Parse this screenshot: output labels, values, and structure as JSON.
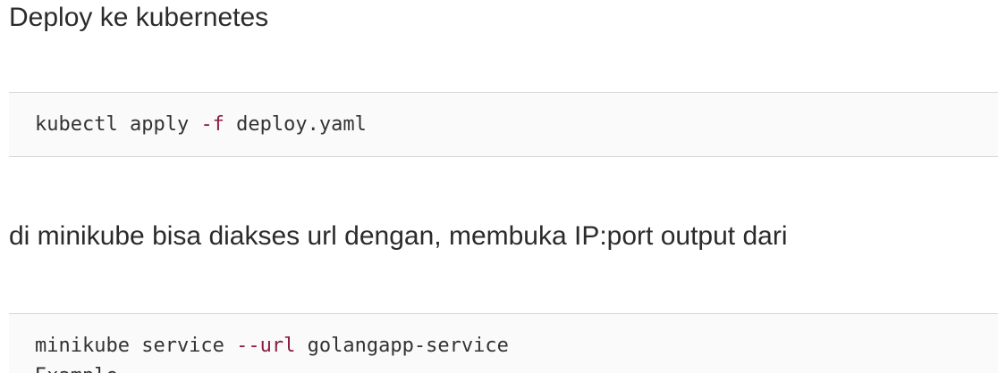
{
  "paragraphs": [
    {
      "text": "Deploy ke kubernetes"
    },
    {
      "text": "di minikube bisa diakses url dengan, membuka IP:port output dari"
    }
  ],
  "code_blocks": [
    {
      "lines": [
        {
          "cmd": "kubectl apply ",
          "flag": "-f",
          "rest": " deploy.yaml"
        }
      ]
    },
    {
      "lines": [
        {
          "cmd": "minikube service ",
          "flag": "--url",
          "rest": " golangapp-service"
        },
        {
          "cmd": "Example",
          "flag": "",
          "rest": ""
        }
      ]
    }
  ],
  "colors": {
    "flag": "#8b1d3f",
    "code_background": "#fafafa",
    "border": "#d6d6d6"
  }
}
